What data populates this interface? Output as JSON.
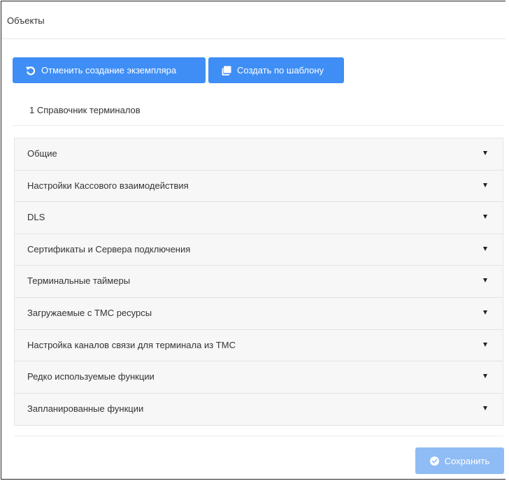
{
  "header": {
    "title": "Объекты"
  },
  "toolbar": {
    "cancel_label": "Отменить создание экземпляра",
    "cancel_icon": "undo-icon",
    "template_label": "Создать по шаблону",
    "template_icon": "copy-icon"
  },
  "subtitle": "1 Справочник терминалов",
  "accordion": {
    "items": [
      {
        "label": "Общие"
      },
      {
        "label": "Настройки Кассового взаимодействия"
      },
      {
        "label": "DLS"
      },
      {
        "label": "Сертификаты и Сервера подключения"
      },
      {
        "label": "Терминальные таймеры"
      },
      {
        "label": "Загружаемые с ТМС ресурсы"
      },
      {
        "label": "Настройка каналов связи для терминала из ТМС"
      },
      {
        "label": "Редко используемые функции"
      },
      {
        "label": "Запланированные функции"
      }
    ]
  },
  "footer": {
    "save_label": "Сохранить",
    "save_icon": "check-circle-icon",
    "save_disabled": true
  },
  "colors": {
    "primary": "#3f8ef5",
    "primary_disabled": "#8fbcf5",
    "panel_bg": "#f7f7f7",
    "border": "#e3e3e3"
  }
}
